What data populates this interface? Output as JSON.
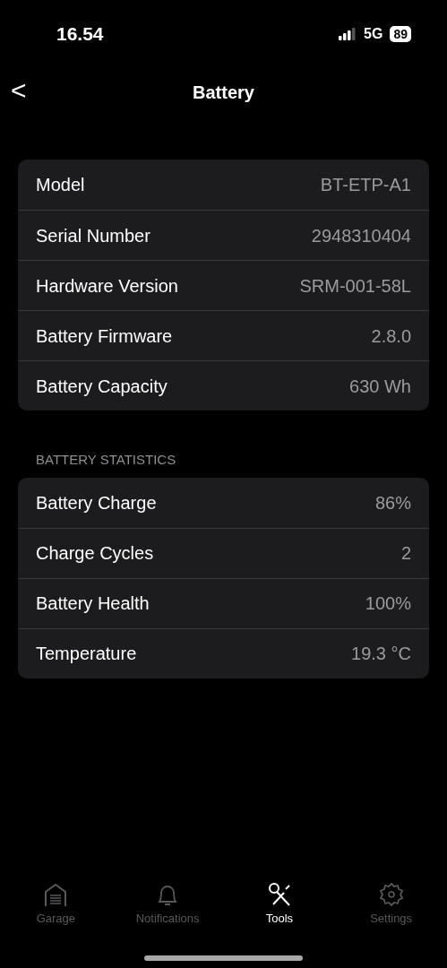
{
  "status_bar": {
    "time": "16.54",
    "network": "5G",
    "battery": "89"
  },
  "nav": {
    "back": "<",
    "title": "Battery"
  },
  "sections": [
    {
      "rows": [
        {
          "label": "Model",
          "value": "BT-ETP-A1"
        },
        {
          "label": "Serial Number",
          "value": "2948310404"
        },
        {
          "label": "Hardware Version",
          "value": "SRM-001-58L"
        },
        {
          "label": "Battery Firmware",
          "value": "2.8.0"
        },
        {
          "label": "Battery Capacity",
          "value": "630 Wh"
        }
      ]
    },
    {
      "header": "BATTERY STATISTICS",
      "rows": [
        {
          "label": "Battery Charge",
          "value": "86%"
        },
        {
          "label": "Charge Cycles",
          "value": "2"
        },
        {
          "label": "Battery Health",
          "value": "100%"
        },
        {
          "label": "Temperature",
          "value": "19.3 °C"
        }
      ]
    }
  ],
  "tab_bar": [
    {
      "kind": "garage",
      "label": "Garage",
      "selected": false
    },
    {
      "kind": "bell",
      "label": "Notifications",
      "selected": false
    },
    {
      "kind": "tools",
      "label": "Tools",
      "selected": true
    },
    {
      "kind": "gear",
      "label": "Settings",
      "selected": false
    }
  ]
}
